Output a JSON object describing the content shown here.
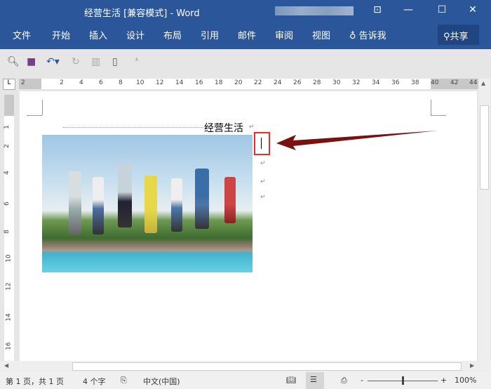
{
  "window": {
    "title": "经营生活 [兼容模式]  -  Word",
    "controls": [
      "restore-ribbon",
      "minimize",
      "maximize",
      "close"
    ]
  },
  "menu": {
    "items": [
      "文件",
      "开始",
      "插入",
      "设计",
      "布局",
      "引用",
      "邮件",
      "审阅",
      "视图"
    ],
    "tell_me": "告诉我",
    "share": "共享"
  },
  "ruler": {
    "horizontal": [
      "2",
      "2",
      "4",
      "6",
      "8",
      "10",
      "12",
      "14",
      "16",
      "18",
      "20",
      "22",
      "24",
      "26",
      "28",
      "30",
      "32",
      "34",
      "36",
      "38",
      "40",
      "42",
      "44"
    ],
    "vertical": [
      "1",
      "2",
      "4",
      "6",
      "8",
      "10",
      "12",
      "14",
      "16"
    ]
  },
  "document": {
    "heading": "经营生活",
    "paragraph_mark": "↵"
  },
  "status": {
    "page": "第 1 页，共 1 页",
    "words": "4 个字",
    "language": "中文(中国)",
    "zoom": "100%"
  },
  "colors": {
    "brand": "#2b579a",
    "arrow": "#7a1010",
    "highlight": "#e03030"
  }
}
